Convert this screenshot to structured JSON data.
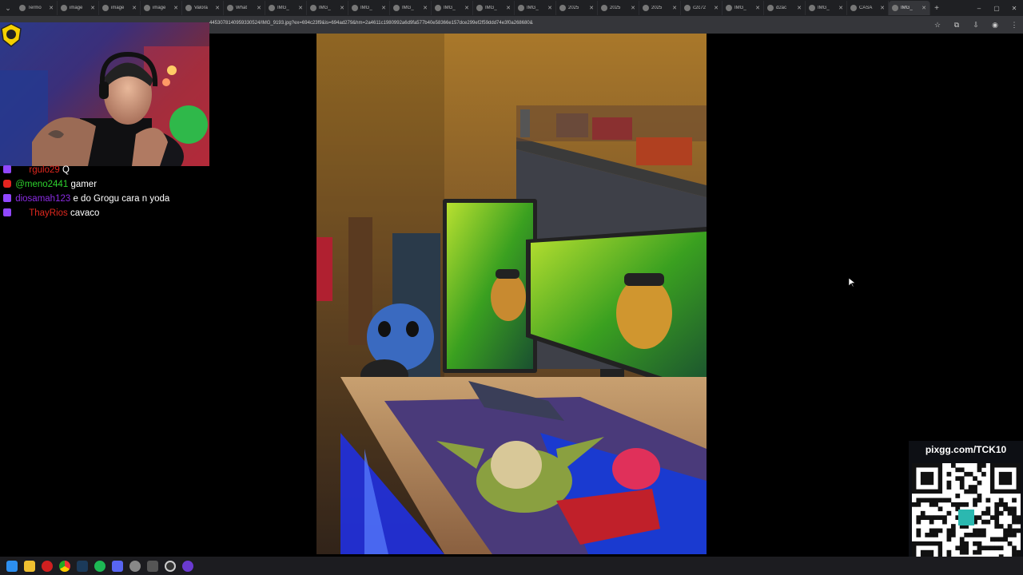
{
  "browser": {
    "tabs": [
      {
        "title": "Termo"
      },
      {
        "title": "image"
      },
      {
        "title": "image"
      },
      {
        "title": "image"
      },
      {
        "title": "Valora"
      },
      {
        "title": "What"
      },
      {
        "title": "IMG_"
      },
      {
        "title": "IMG_"
      },
      {
        "title": "IMG_"
      },
      {
        "title": "IMG_"
      },
      {
        "title": "IMG_"
      },
      {
        "title": "IMG_"
      },
      {
        "title": "IMG_"
      },
      {
        "title": "2025"
      },
      {
        "title": "2025"
      },
      {
        "title": "2025"
      },
      {
        "title": "c2c72"
      },
      {
        "title": "IMG_"
      },
      {
        "title": "d2ac"
      },
      {
        "title": "IMG_"
      },
      {
        "title": "CASA"
      },
      {
        "title": "IMG_"
      }
    ],
    "active_tab_index": 21,
    "url": "4453078140959330524/IMG_9193.jpg?ex=694c23f9&is=694ad279&hm=2a4611c1980992a6d9fa577b40e58366e157dce299ef2f59ddd74e3f0a268680&"
  },
  "chat": {
    "messages": [
      {
        "platform": "twitch",
        "user": "rgulo29",
        "text": "Q",
        "user_color": "#e0281e"
      },
      {
        "platform": "youtube",
        "user": "@meno2441",
        "text": "gamer",
        "user_color": "#2ed12e"
      },
      {
        "platform": "twitch",
        "user": "diosamah123",
        "text": "e do Grogu cara n yoda",
        "user_color": "#8a2be2"
      },
      {
        "platform": "twitch",
        "user": "ThayRios",
        "text": "cavaco",
        "user_color": "#e0281e"
      }
    ]
  },
  "qr": {
    "label": "pixgg.com/TCK10"
  }
}
